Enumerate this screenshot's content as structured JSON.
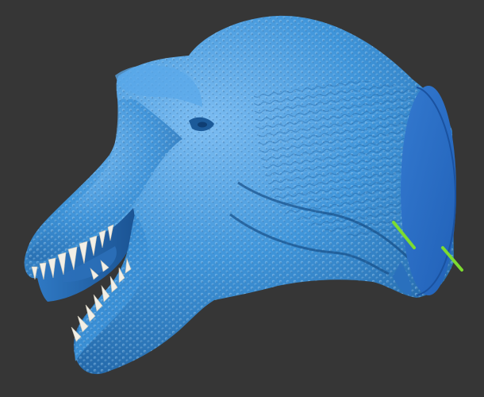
{
  "viewport": {
    "background_color": "#363636"
  },
  "model": {
    "subject": "t-rex-head",
    "base_color": "#3a8fd6",
    "highlight_color": "#6fb4ef",
    "shadow_color": "#1f5f9f",
    "cut_face_color": "#2a6fc7",
    "teeth_color": "#f2efe6"
  },
  "markers": {
    "color": "#7ddc2f",
    "count": 2
  }
}
